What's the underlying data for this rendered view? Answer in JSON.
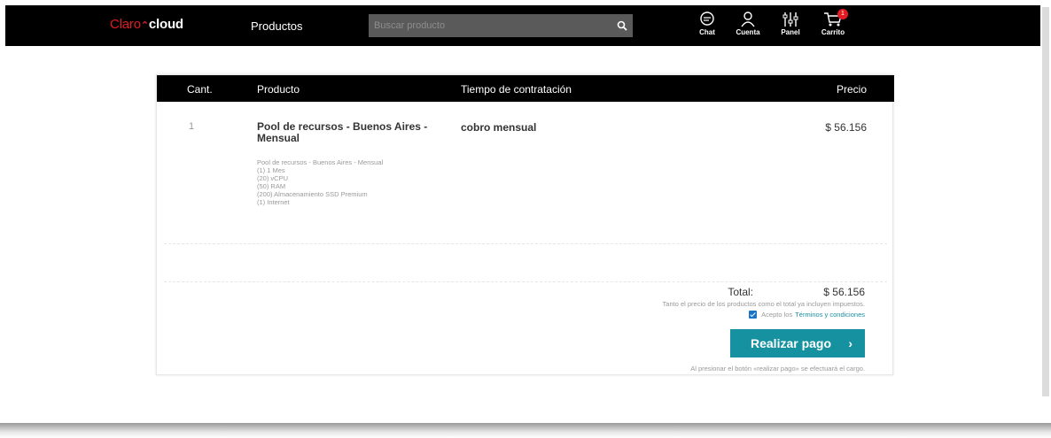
{
  "header": {
    "logo_claro": "Claro",
    "logo_cloud": "cloud",
    "nav_productos": "Productos",
    "search_placeholder": "Buscar producto",
    "icons": [
      {
        "name": "chat-icon",
        "label": "Chat"
      },
      {
        "name": "user-icon",
        "label": "Cuenta"
      },
      {
        "name": "panel-icon",
        "label": "Panel"
      },
      {
        "name": "cart-icon",
        "label": "Carrito"
      }
    ],
    "cart_badge": "1"
  },
  "table": {
    "headers": {
      "qty": "Cant.",
      "product": "Producto",
      "term": "Tiempo de contratación",
      "price": "Precio"
    },
    "rows": [
      {
        "qty": "1",
        "product_name": "Pool de recursos - Buenos Aires - Mensual",
        "details": [
          "Pool de recursos - Buenos Aires - Mensual",
          "(1) 1 Mes",
          "(20) vCPU",
          "(50) RAM",
          "(200) Almacenamiento SSD Premium",
          "(1) Internet"
        ],
        "term": "cobro mensual",
        "price": "$ 56.156"
      }
    ]
  },
  "summary": {
    "total_label": "Total:",
    "total_value": "$ 56.156",
    "tax_note": "Tanto el precio de los productos como el total ya incluyen impuestos.",
    "terms_prefix": "Acepto los",
    "terms_link": "Términos y condiciones",
    "terms_checked": true,
    "pay_button": "Realizar pago",
    "pay_chevron": "›",
    "pay_note": "Al presionar el botón «realizar pago» se efectuará el cargo."
  },
  "colors": {
    "brand_red": "#e11b22",
    "accent_teal": "#16919f",
    "header_bg": "#000000"
  }
}
